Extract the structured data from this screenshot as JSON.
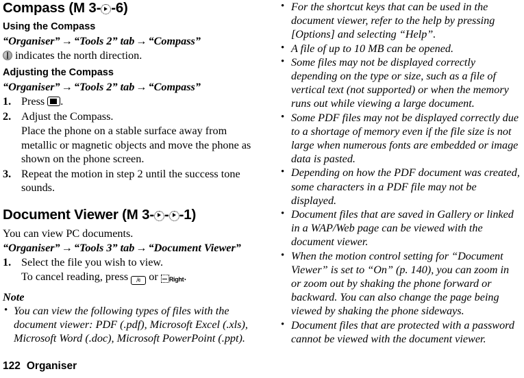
{
  "footer": {
    "page_number": "122",
    "chapter": "Organiser"
  },
  "left_column": {
    "compass": {
      "title_prefix": "Compass (M 3-",
      "title_suffix": "-6)",
      "using_heading": "Using the Compass",
      "using_path": {
        "part1": "“Organiser”",
        "arrow1": "→",
        "part2": "“Tools 2” tab",
        "arrow2": "→",
        "part3": "“Compass”"
      },
      "north_line": "indicates the north direction.",
      "adjusting_heading": "Adjusting the Compass",
      "adjusting_path": {
        "part1": "“Organiser”",
        "arrow1": "→",
        "part2": "“Tools 2” tab",
        "arrow2": "→",
        "part3": "“Compass”"
      },
      "steps": [
        {
          "num": "1.",
          "text_before_key": "Press",
          "text_after_key": "."
        },
        {
          "num": "2.",
          "text": "Adjust the Compass.",
          "detail": "Place the phone on a stable surface away from metallic or magnetic objects and move the phone as shown on the phone screen."
        },
        {
          "num": "3.",
          "text": "Repeat the motion in step 2 until the success tone sounds."
        }
      ]
    },
    "document_viewer": {
      "title_prefix": "Document Viewer (M 3-",
      "title_middle": "-",
      "title_suffix": "-1)",
      "intro": "You can view PC documents.",
      "path": {
        "part1": "“Organiser”",
        "arrow1": "→",
        "part2": "“Tools 3” tab",
        "arrow2": "→",
        "part3": "“Document Viewer”"
      },
      "steps": [
        {
          "num": "1.",
          "text": "Select the file you wish to view."
        }
      ],
      "cancel_line": {
        "before": "To cancel reading, press",
        "clear_key_label": "⧸c",
        "middle": "or",
        "soft_key_label": "Right",
        "after": "."
      },
      "note_heading": "Note",
      "notes": [
        "You can view the following types of files with the document viewer: PDF (.pdf), Microsoft Excel (.xls), Microsoft Word (.doc), Microsoft PowerPoint (.ppt)."
      ]
    }
  },
  "right_column": {
    "notes": [
      "For the shortcut keys that can be used in the document viewer, refer to the help by pressing [Options] and selecting “Help”.",
      "A file of up to 10 MB can be opened.",
      "Some files may not be displayed correctly depending on the type or size, such as a file of vertical text (not supported) or when the memory runs out while viewing a large document.",
      "Some PDF files may not be displayed correctly due to a shortage of memory even if the file size is not large when numerous fonts are embedded or image data is pasted.",
      "Depending on how the PDF document was created, some characters in a PDF file may not be displayed.",
      "Document files that are saved in Gallery or linked in a WAP/Web page can be viewed with the document viewer.",
      "When the motion control setting for “Document Viewer” is set to “On” (p. 140), you can zoom in or zoom out by shaking the phone forward or backward. You can also change the page being viewed by shaking the phone sideways.",
      "Document files that are protected with a password cannot be viewed with the document viewer."
    ],
    "bullet_char": "•"
  }
}
